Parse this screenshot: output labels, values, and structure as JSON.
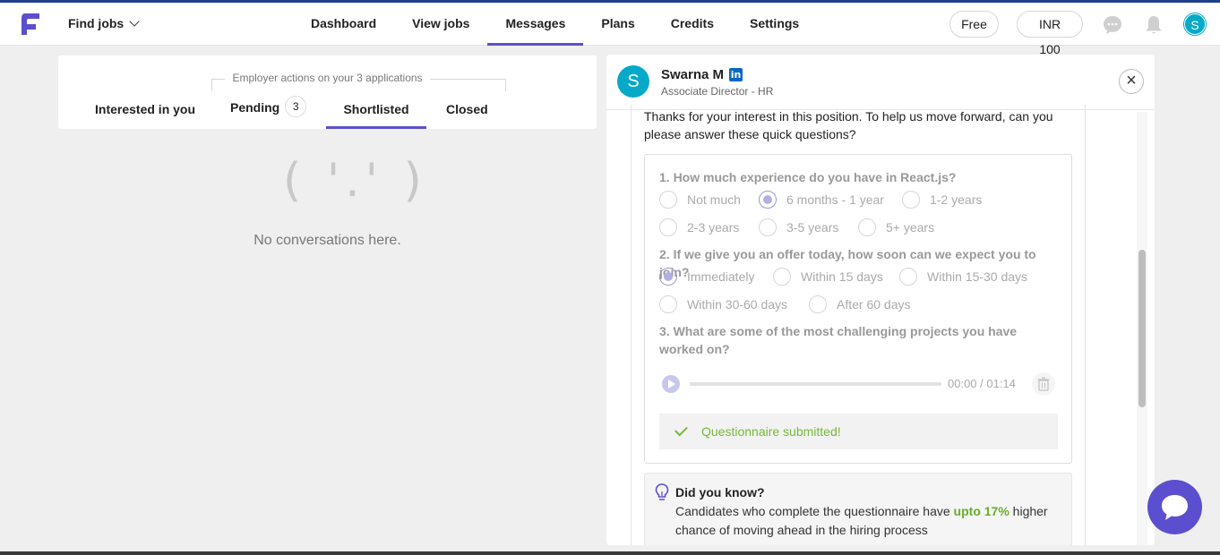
{
  "topbar": {
    "find_jobs": "Find jobs",
    "nav": [
      "Dashboard",
      "View jobs",
      "Messages",
      "Plans",
      "Credits",
      "Settings"
    ],
    "active_nav": "Messages",
    "plan_badge": "Free",
    "credits_badge": "INR 100",
    "avatar_initial": "S",
    "accent_color": "#5b4fcf"
  },
  "applications": {
    "employer_actions_label": "Employer actions on your 3 applications",
    "tabs": [
      {
        "label": "Interested in you"
      },
      {
        "label": "Pending",
        "count": "3"
      },
      {
        "label": "Shortlisted"
      },
      {
        "label": "Closed"
      }
    ],
    "active_tab": "Shortlisted",
    "empty_face": "( '.' )",
    "empty_text": "No conversations here."
  },
  "conversation": {
    "recruiter_name": "Swarna M",
    "linkedin_badge": "in",
    "recruiter_role": "Associate Director - HR",
    "avatar_initial": "S",
    "close_symbol": "×",
    "message": "Thanks for your interest in this position. To help us move forward, can you please answer these quick questions?",
    "questions": [
      {
        "title": "1. How much experience do you have in React.js?",
        "options": [
          "Not much",
          "6 months - 1 year",
          "1-2 years",
          "2-3 years",
          "3-5 years",
          "5+ years"
        ],
        "selected": "6 months - 1 year"
      },
      {
        "title": "2. If we give you an offer today, how soon can we expect you to join?",
        "options": [
          "Immediately",
          "Within 15 days",
          "Within 15-30 days",
          "Within 30-60 days",
          "After 60 days"
        ],
        "selected": "Immediately"
      },
      {
        "title": "3. What are some of the most challenging projects you have worked on?",
        "audio_time": "00:00 / 01:14"
      }
    ],
    "submitted_text": "Questionnaire submitted!",
    "did_you_know": {
      "title": "Did you know?",
      "text_before": "Candidates who complete the questionnaire have ",
      "highlight": "upto 17%",
      "text_after": " higher chance of moving ahead in the hiring process"
    }
  }
}
